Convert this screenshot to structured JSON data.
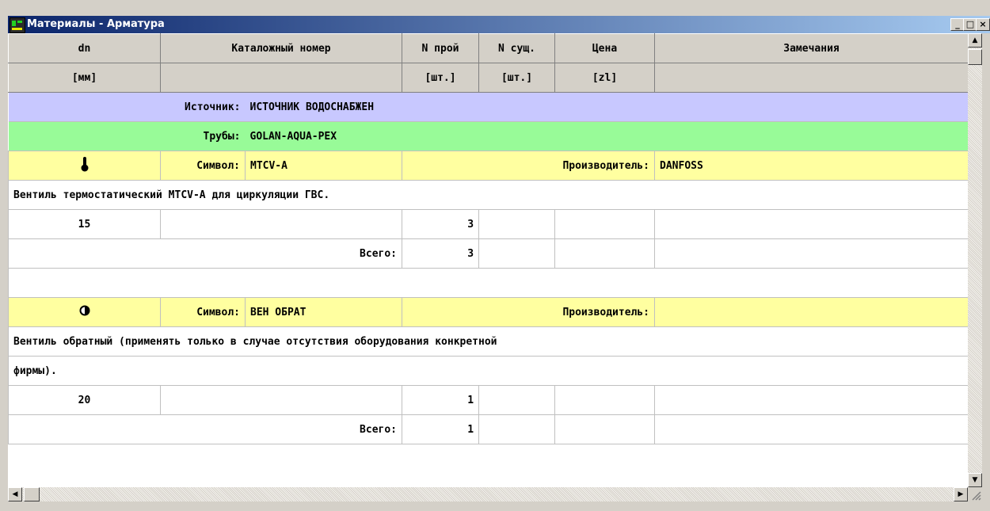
{
  "window": {
    "title": "Материалы - Арматура",
    "controls": {
      "minimize": "_",
      "maximize": "□",
      "close": "×"
    }
  },
  "columns": {
    "dn": "dn",
    "catalog": "Каталожный номер",
    "n_design": "N прой",
    "n_exist": "N сущ.",
    "price": "Цена",
    "remarks": "Замечания"
  },
  "units": {
    "dn": "[мм]",
    "n_design": "[шт.]",
    "n_exist": "[шт.]",
    "price": "[zl]"
  },
  "source": {
    "label": "Источник:",
    "value": "ИСТОЧНИК ВОДОСНАБЖЕН"
  },
  "pipes": {
    "label": "Трубы:",
    "value": "GOLAN-AQUA-PEX"
  },
  "items": [
    {
      "icon": "thermostat-icon",
      "symbol_label": "Символ:",
      "symbol": "MTCV-A",
      "manufacturer_label": "Производитель:",
      "manufacturer": "DANFOSS",
      "description": "Вентиль термостатический MTCV-A для циркуляции ГВС.",
      "rows": [
        {
          "dn": "15",
          "qty": "3"
        }
      ],
      "total_label": "Всего:",
      "total": "3"
    },
    {
      "icon": "check-valve-icon",
      "symbol_label": "Символ:",
      "symbol": "ВЕН ОБРАТ",
      "manufacturer_label": "Производитель:",
      "manufacturer": "",
      "description_line1": "Вентиль обратный (применять только в случае отсутствия оборудования конкретной",
      "description_line2": "фирмы).",
      "rows": [
        {
          "dn": "20",
          "qty": "1"
        }
      ],
      "total_label": "Всего:",
      "total": "1"
    }
  ],
  "colors": {
    "source_row": "#c8c8ff",
    "pipes_row": "#98fb98",
    "symbol_row": "#ffffa0",
    "titlebar": "#0a246a"
  }
}
